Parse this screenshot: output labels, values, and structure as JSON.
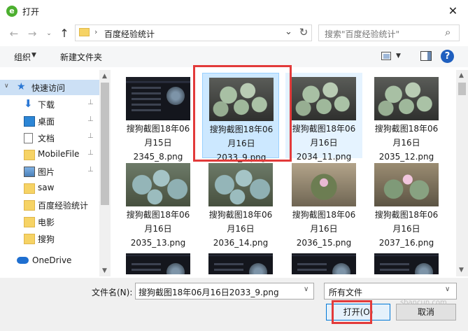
{
  "window": {
    "title": "打开",
    "app_icon": "e",
    "close_glyph": "✕"
  },
  "nav": {
    "back": "←",
    "forward": "→",
    "recent": "⌄",
    "up": "↑",
    "breadcrumb_sep": "›",
    "breadcrumb": "百度经验统计",
    "address_drop": "⌄",
    "refresh": "↻"
  },
  "search": {
    "placeholder": "搜索\"百度经验统计\"",
    "icon": "⌕"
  },
  "toolbar": {
    "organize": "组织",
    "caret": "▼",
    "new_folder": "新建文件夹",
    "help": "?"
  },
  "sidebar": {
    "quick_access": {
      "label": "快速访问",
      "chevron": "∨",
      "star": "★"
    },
    "pin_glyph": "📌",
    "items": [
      {
        "label": "下载",
        "pinned": true
      },
      {
        "label": "桌面",
        "pinned": true
      },
      {
        "label": "文档",
        "pinned": true
      },
      {
        "label": "MobileFile",
        "pinned": true
      },
      {
        "label": "图片",
        "pinned": true
      },
      {
        "label": "saw",
        "pinned": false
      },
      {
        "label": "百度经验统计",
        "pinned": false
      },
      {
        "label": "电影",
        "pinned": false
      },
      {
        "label": "搜狗",
        "pinned": false
      }
    ],
    "onedrive": "OneDrive",
    "scroll_up": "▲",
    "scroll_down": "▼"
  },
  "files": [
    {
      "name": "搜狗截图18年06\n月15日\n2345_8.png",
      "thumb": "screen",
      "selected": false
    },
    {
      "name": "搜狗截图18年06\n月16日\n2033_9.png",
      "thumb": "cactus",
      "selected": true
    },
    {
      "name": "搜狗截图18年06\n月16日\n2034_11.png",
      "thumb": "cactus",
      "selected": false
    },
    {
      "name": "搜狗截图18年06\n月16日\n2035_12.png",
      "thumb": "cactus",
      "selected": false
    },
    {
      "name": "搜狗截图18年06\n月16日\n2035_13.png",
      "thumb": "cactus2",
      "selected": false
    },
    {
      "name": "搜狗截图18年06\n月16日\n2036_14.png",
      "thumb": "cactus2",
      "selected": false
    },
    {
      "name": "搜狗截图18年06\n月16日\n2036_15.png",
      "thumb": "flower",
      "selected": false
    },
    {
      "name": "搜狗截图18年06\n月16日\n2037_16.png",
      "thumb": "flower2",
      "selected": false
    },
    {
      "name": "",
      "thumb": "screen",
      "selected": false
    },
    {
      "name": "",
      "thumb": "screen",
      "selected": false
    },
    {
      "name": "",
      "thumb": "screen",
      "selected": false
    },
    {
      "name": "",
      "thumb": "screen",
      "selected": false
    }
  ],
  "bottom": {
    "filename_label": "文件名(N):",
    "filename_value": "搜狗截图18年06月16日2033_9.png",
    "filter_value": "所有文件",
    "drop_glyph": "∨",
    "open_label": "打开(O)",
    "cancel_label": "取消",
    "watermark": "shancun.com"
  },
  "colors": {
    "selection": "#cce8ff",
    "highlight": "#e23a3a",
    "accent": "#0078d7"
  }
}
